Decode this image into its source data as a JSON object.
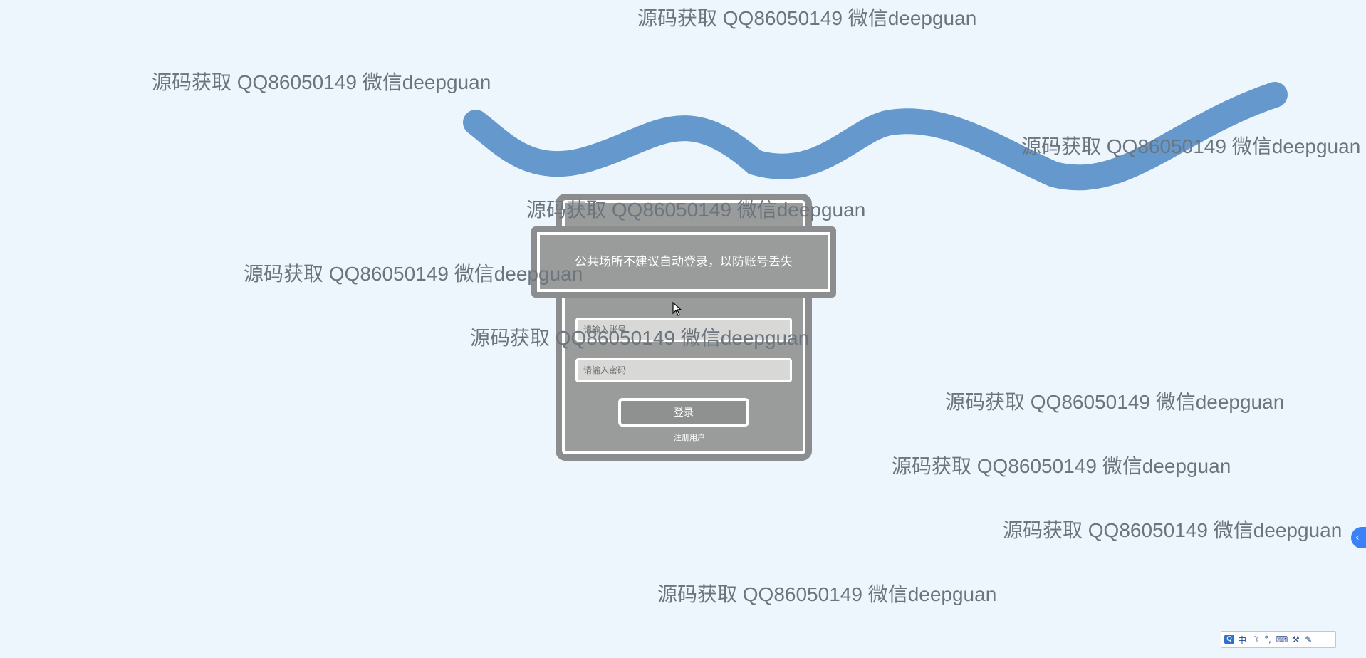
{
  "notice": {
    "text": "公共场所不建议自动登录，以防账号丢失"
  },
  "login": {
    "username_placeholder": "请输入账号",
    "password_placeholder": "请输入密码",
    "login_label": "登录",
    "register_label": "注册用户"
  },
  "watermark_text": "源码获取 QQ86050149 微信deepguan",
  "side_button": {
    "glyph": "‹"
  },
  "ime_toolbar": {
    "items": [
      {
        "name": "ime-logo-icon",
        "glyph": "Q"
      },
      {
        "name": "chinese-mode-icon",
        "glyph": "中"
      },
      {
        "name": "moon-icon",
        "glyph": "☽"
      },
      {
        "name": "punctuation-icon",
        "glyph": "°,"
      },
      {
        "name": "keyboard-icon",
        "glyph": "⌨"
      },
      {
        "name": "tool-icon",
        "glyph": "⚒"
      },
      {
        "name": "settings-icon",
        "glyph": "✎"
      }
    ]
  },
  "colors": {
    "background": "#eef6fd",
    "wave": "#6598cc",
    "card": "#9a9b9b",
    "watermark": "#6c757d",
    "accent": "#3b82f6"
  }
}
